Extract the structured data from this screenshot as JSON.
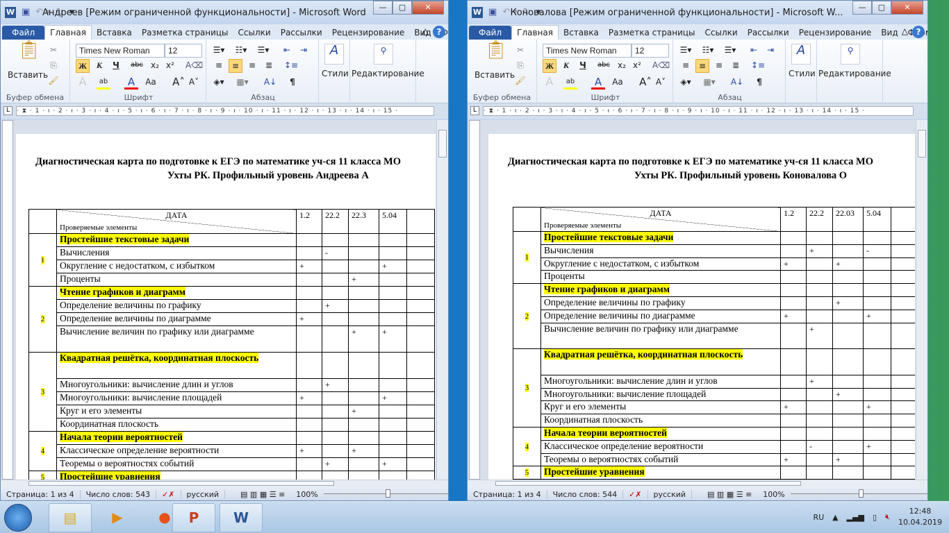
{
  "ribbon_common": {
    "tabs": [
      "Файл",
      "Главная",
      "Вставка",
      "Разметка страницы",
      "Ссылки",
      "Рассылки",
      "Рецензирование",
      "Вид",
      "Формула"
    ],
    "paste": "Вставить",
    "clipboard_group": "Буфер обмена",
    "font_name": "Times New Roman",
    "font_size": "12",
    "font_group": "Шрифт",
    "paragraph_group": "Абзац",
    "styles": "Стили",
    "editing": "Редактирование",
    "bold": "Ж",
    "italic": "К",
    "underline": "Ч",
    "app": "Microsoft Word"
  },
  "windows": [
    {
      "title": "Андреев [Режим ограниченной функциональности]  -  Microsoft Word",
      "doc_title_1": "Диагностическая карта по подготовке к ЕГЭ по математике уч-ся 11 класса МО",
      "doc_title_2": "Ухты РК. Профильный  уровень Андреева А",
      "header_date": "ДАТА",
      "header_elements": "Проверяемые элементы",
      "dates": [
        "1.2",
        "22.2",
        "22.3",
        "5.04",
        ""
      ],
      "page": "Страница: 1 из 4",
      "words": "Число слов: 543",
      "language": "русский",
      "zoom": "100%",
      "marks": [
        [
          "",
          "",
          "",
          "",
          ""
        ],
        [
          "",
          "-",
          "",
          "",
          ""
        ],
        [
          "+",
          "",
          "",
          "+",
          ""
        ],
        [
          "",
          "",
          "+",
          "",
          ""
        ],
        [
          "",
          "",
          "",
          "",
          ""
        ],
        [
          "",
          "+",
          "",
          "",
          ""
        ],
        [
          "+",
          "",
          "",
          "",
          ""
        ],
        [
          "",
          "",
          "+",
          "+",
          ""
        ],
        [
          "",
          "",
          "",
          "",
          ""
        ],
        [
          "",
          "+",
          "",
          "",
          ""
        ],
        [
          "+",
          "",
          "",
          "+",
          ""
        ],
        [
          "",
          "",
          "+",
          "",
          ""
        ],
        [
          "",
          "",
          "",
          "",
          ""
        ],
        [
          "",
          "",
          "",
          "",
          ""
        ],
        [
          "+",
          "",
          "+",
          "",
          ""
        ],
        [
          "",
          "+",
          "",
          "+",
          ""
        ],
        [
          "",
          "",
          "",
          "",
          ""
        ]
      ]
    },
    {
      "title": "Коновалова [Режим ограниченной функциональности]  -  Microsoft W...",
      "doc_title_1": "Диагностическая карта по подготовке к ЕГЭ по математике уч-ся 11 класса МО",
      "doc_title_2": "Ухты РК. Профильный  уровень Коновалова О",
      "header_date": "ДАТА",
      "header_elements": "Проверяемые элементы",
      "dates": [
        "1.2",
        "22.2",
        "22.03",
        "5.04",
        ""
      ],
      "page": "Страница: 1 из 4",
      "words": "Число слов: 544",
      "language": "русский",
      "zoom": "100%",
      "marks": [
        [
          "",
          "",
          "",
          "",
          ""
        ],
        [
          "",
          "+",
          "",
          "-",
          ""
        ],
        [
          "+",
          "",
          "+",
          "",
          ""
        ],
        [
          "",
          "",
          "",
          "",
          ""
        ],
        [
          "",
          "",
          "",
          "",
          ""
        ],
        [
          "",
          "",
          "+",
          "",
          ""
        ],
        [
          "+",
          "",
          "",
          "+",
          ""
        ],
        [
          "",
          "+",
          "",
          "",
          ""
        ],
        [
          "",
          "",
          "",
          "",
          ""
        ],
        [
          "",
          "+",
          "",
          "",
          ""
        ],
        [
          "",
          "",
          "+",
          "",
          ""
        ],
        [
          "+",
          "",
          "",
          "+",
          ""
        ],
        [
          "",
          "",
          "",
          "",
          ""
        ],
        [
          "",
          "",
          "",
          "",
          ""
        ],
        [
          "",
          "-",
          "",
          "+",
          ""
        ],
        [
          "+",
          "",
          "+",
          "",
          ""
        ],
        [
          "",
          "",
          "",
          "",
          ""
        ]
      ]
    }
  ],
  "rows": [
    {
      "group": "1",
      "text": "Простейшие текстовые задачи",
      "heading": true,
      "tall": false
    },
    {
      "text": "Вычисления"
    },
    {
      "text": "Округление с недостатком, с избытком"
    },
    {
      "text": "Проценты"
    },
    {
      "group": "2",
      "text": "Чтение графиков и диаграмм",
      "heading": true
    },
    {
      "text": "Определение величины по графику"
    },
    {
      "text": "Определение величины по диаграмме"
    },
    {
      "text": "Вычисление величин по графику или диаграмме",
      "tall": true
    },
    {
      "group": "3",
      "text": "Квадратная решётка, координатная плоскость",
      "heading": true,
      "tall": true
    },
    {
      "text": "Многоугольники: вычисление длин и углов"
    },
    {
      "text": "Многоугольники: вычисление площадей"
    },
    {
      "text": "Круг и его элементы"
    },
    {
      "text": "Координатная плоскость"
    },
    {
      "group": "4",
      "text": "Начала теории вероятностей",
      "heading": true
    },
    {
      "text": "Классическое определение вероятности"
    },
    {
      "text": "Теоремы о вероятностях событий"
    },
    {
      "group": "5",
      "text": "Простейшие уравнения",
      "heading": true
    }
  ],
  "group_sizes": {
    "1": 4,
    "2": 4,
    "3": 5,
    "4": 3,
    "5": 1
  },
  "taskbar": {
    "apps": [
      "explorer",
      "media-player",
      "firefox",
      "powerpoint",
      "word"
    ],
    "lang": "RU",
    "time": "12:48",
    "date": "10.04.2019"
  }
}
